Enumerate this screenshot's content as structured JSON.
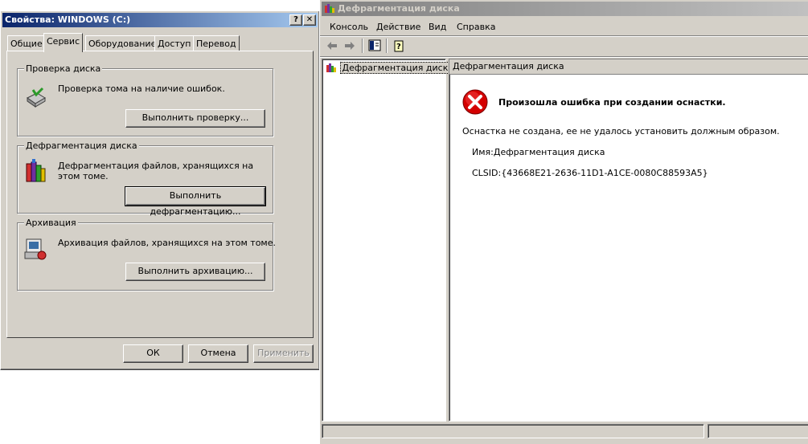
{
  "props": {
    "title": "Свойства: WINDOWS (C:)",
    "title_buttons": [
      "?",
      "✕"
    ],
    "tabs": [
      "Общие",
      "Сервис",
      "Оборудование",
      "Доступ",
      "Перевод"
    ],
    "active_tab": "Сервис",
    "groups": [
      {
        "title": "Проверка диска",
        "text": "Проверка тома на наличие ошибок.",
        "button": "Выполнить проверку..."
      },
      {
        "title": "Дефрагментация диска",
        "text": "Дефрагментация файлов, хранящихся на этом томе.",
        "button": "Выполнить дефрагментацию..."
      },
      {
        "title": "Архивация",
        "text": "Архивация файлов, хранящихся на этом томе.",
        "button": "Выполнить архивацию..."
      }
    ],
    "ok": "ОК",
    "cancel": "Отмена",
    "apply": "Применить"
  },
  "mmc": {
    "title": "Дефрагментация диска",
    "menu": [
      "Консоль",
      "Действие",
      "Вид",
      "Справка"
    ],
    "tree_item": "Дефрагментация диска",
    "pane_header": "Дефрагментация диска",
    "error_title": "Произошла ошибка при создании оснастки.",
    "error_desc": "Оснастка не создана, ее не удалось установить должным образом.",
    "name_line": "Имя:Дефрагментация диска",
    "clsid_line": "CLSID:{43668E21-2636-11D1-A1CE-0080C88593A5}"
  },
  "colors": {
    "title_active": "#0a246a",
    "title_active_end": "#a6caf0",
    "title_inactive": "#808080",
    "title_inactive_end": "#c0c0c0",
    "face": "#d4d0c8",
    "error_red": "#d40000"
  }
}
